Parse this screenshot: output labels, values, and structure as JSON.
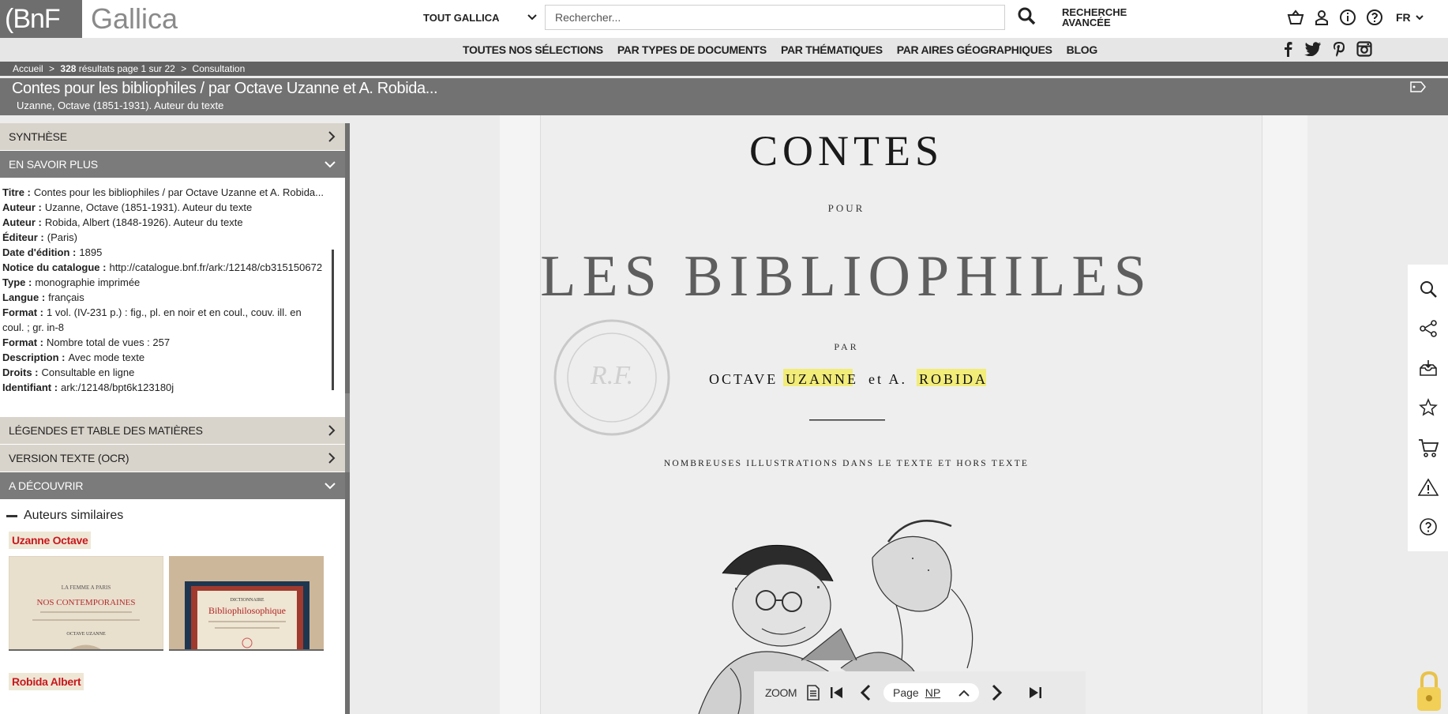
{
  "header": {
    "logo_bnf": "(BnF",
    "logo_gallica": "Gallica",
    "scope_selected": "TOUT GALLICA",
    "search_placeholder": "Rechercher...",
    "advanced_line1": "RECHERCHE",
    "advanced_line2": "AVANCÉE",
    "lang": "FR"
  },
  "nav": {
    "items": [
      "TOUTES NOS SÉLECTIONS",
      "PAR TYPES DE DOCUMENTS",
      "PAR THÉMATIQUES",
      "PAR AIRES GÉOGRAPHIQUES",
      "BLOG"
    ]
  },
  "breadcrumb": {
    "home": "Accueil",
    "sep": ">",
    "results_count": "328",
    "results_text": "résultats page 1 sur 22",
    "current": "Consultation"
  },
  "document": {
    "title": "Contes pour les bibliophiles / par Octave Uzanne et A. Robida...",
    "author_line": "Uzanne, Octave (1851-1931). Auteur du texte"
  },
  "panel": {
    "synthese": "SYNTHÈSE",
    "en_savoir_plus": "EN SAVOIR PLUS",
    "legendes": "LÉGENDES ET TABLE DES MATIÈRES",
    "ocr": "VERSION TEXTE (OCR)",
    "decouvrir": "A DÉCOUVRIR",
    "similar_heading": "Auteurs similaires",
    "author1": "Uzanne Octave",
    "author2": "Robida Albert"
  },
  "metadata": [
    {
      "label": "Titre :",
      "value": "Contes pour les bibliophiles / par Octave Uzanne et A. Robida..."
    },
    {
      "label": "Auteur :",
      "value": "Uzanne, Octave (1851-1931). Auteur du texte"
    },
    {
      "label": "Auteur :",
      "value": "Robida, Albert (1848-1926). Auteur du texte"
    },
    {
      "label": "Éditeur :",
      "value": "(Paris)"
    },
    {
      "label": "Date d'édition :",
      "value": "1895"
    },
    {
      "label": "Notice du catalogue :",
      "value": "http://catalogue.bnf.fr/ark:/12148/cb315150672"
    },
    {
      "label": "Type :",
      "value": "monographie imprimée"
    },
    {
      "label": "Langue :",
      "value": "français"
    },
    {
      "label": "Format :",
      "value": "1 vol. (IV-231 p.) : fig., pl. en noir et en coul., couv. ill. en coul. ; gr. in-8"
    },
    {
      "label": "Format :",
      "value": "Nombre total de vues : 257"
    },
    {
      "label": "Description :",
      "value": "Avec mode texte"
    },
    {
      "label": "Droits :",
      "value": "Consultable en ligne"
    },
    {
      "label": "Identifiant :",
      "value": "ark:/12148/bpt6k123180j"
    }
  ],
  "thumbnails": [
    {
      "line1": "LA FEMME A PARIS",
      "line2": "NOS CONTEMPORAINES",
      "line3": "OCTAVE UZANNE"
    },
    {
      "line1": "DICTIONNAIRE",
      "line2": "Bibliophilosophique"
    }
  ],
  "scan": {
    "l1": "CONTES",
    "l2": "POUR",
    "l3": "LES BIBLIOPHILES",
    "l4": "PAR",
    "l5a": "OCTAVE",
    "l5b": "UZANNE",
    "l5c": "et A.",
    "l5d": "ROBIDA",
    "l6": "NOMBREUSES ILLUSTRATIONS DANS LE TEXTE ET HORS TEXTE"
  },
  "pager": {
    "zoom": "ZOOM",
    "page_label": "Page",
    "page_value": "NP"
  },
  "colors": {
    "accent_red": "#c8181d",
    "highlight": "#f0ea74",
    "panel_header_light": "#d9d4cb",
    "panel_header_dark": "#7b7b7b"
  }
}
